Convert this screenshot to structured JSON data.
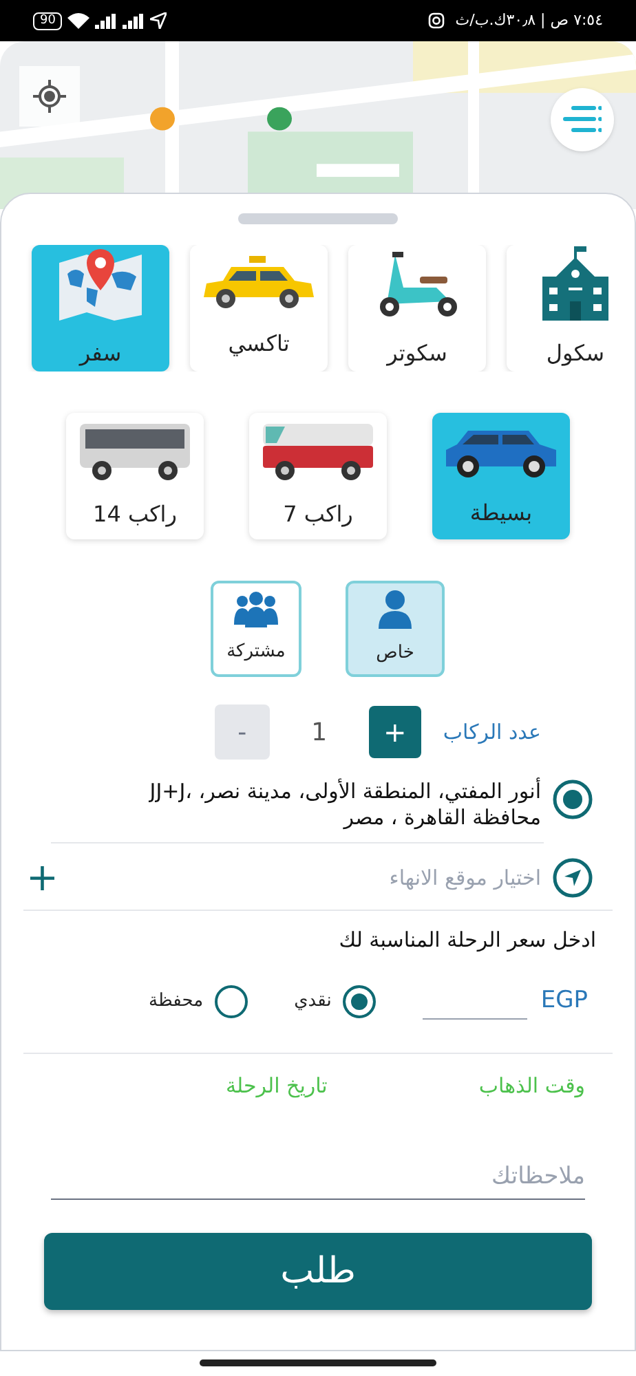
{
  "status_bar": {
    "battery": "90",
    "time": "٧:٥٤ ص | ٣٠٫٨ك.ب/ث"
  },
  "categories": [
    {
      "label": "سكول",
      "kind": "school",
      "selected": false
    },
    {
      "label": "سكوتر",
      "kind": "scooter",
      "selected": false
    },
    {
      "label": "تاكسي",
      "kind": "taxi",
      "selected": false
    },
    {
      "label": "سفر",
      "kind": "travel",
      "selected": true
    }
  ],
  "vehicles": [
    {
      "label": "بسيطة",
      "kind": "car",
      "selected": true
    },
    {
      "label": "7 راكب",
      "kind": "van",
      "selected": false
    },
    {
      "label": "14 راكب",
      "kind": "bus",
      "selected": false
    }
  ],
  "ride_types": [
    {
      "label": "خاص",
      "kind": "single",
      "selected": true
    },
    {
      "label": "مشتركة",
      "kind": "group",
      "selected": false
    }
  ],
  "passengers": {
    "label": "عدد الركاب",
    "plus": "+",
    "count": "1",
    "minus": "-",
    "minus_disabled": true
  },
  "route": {
    "origin": "أنور المفتي، المنطقة الأولى، مدينة نصر، ،JJ+J محافظة القاهرة ، مصر",
    "destination_placeholder": "اختيار موقع الانهاء",
    "add": "+"
  },
  "price": {
    "heading": "ادخل سعر الرحلة المناسبة لك",
    "currency": "EGP",
    "payment": [
      {
        "label": "نقدي",
        "selected": true
      },
      {
        "label": "محفظة",
        "selected": false
      }
    ]
  },
  "schedule": [
    {
      "label": "وقت الذهاب"
    },
    {
      "label": "تاريخ الرحلة"
    }
  ],
  "notes": {
    "placeholder": "ملاحظاتك"
  },
  "submit": "طلب"
}
